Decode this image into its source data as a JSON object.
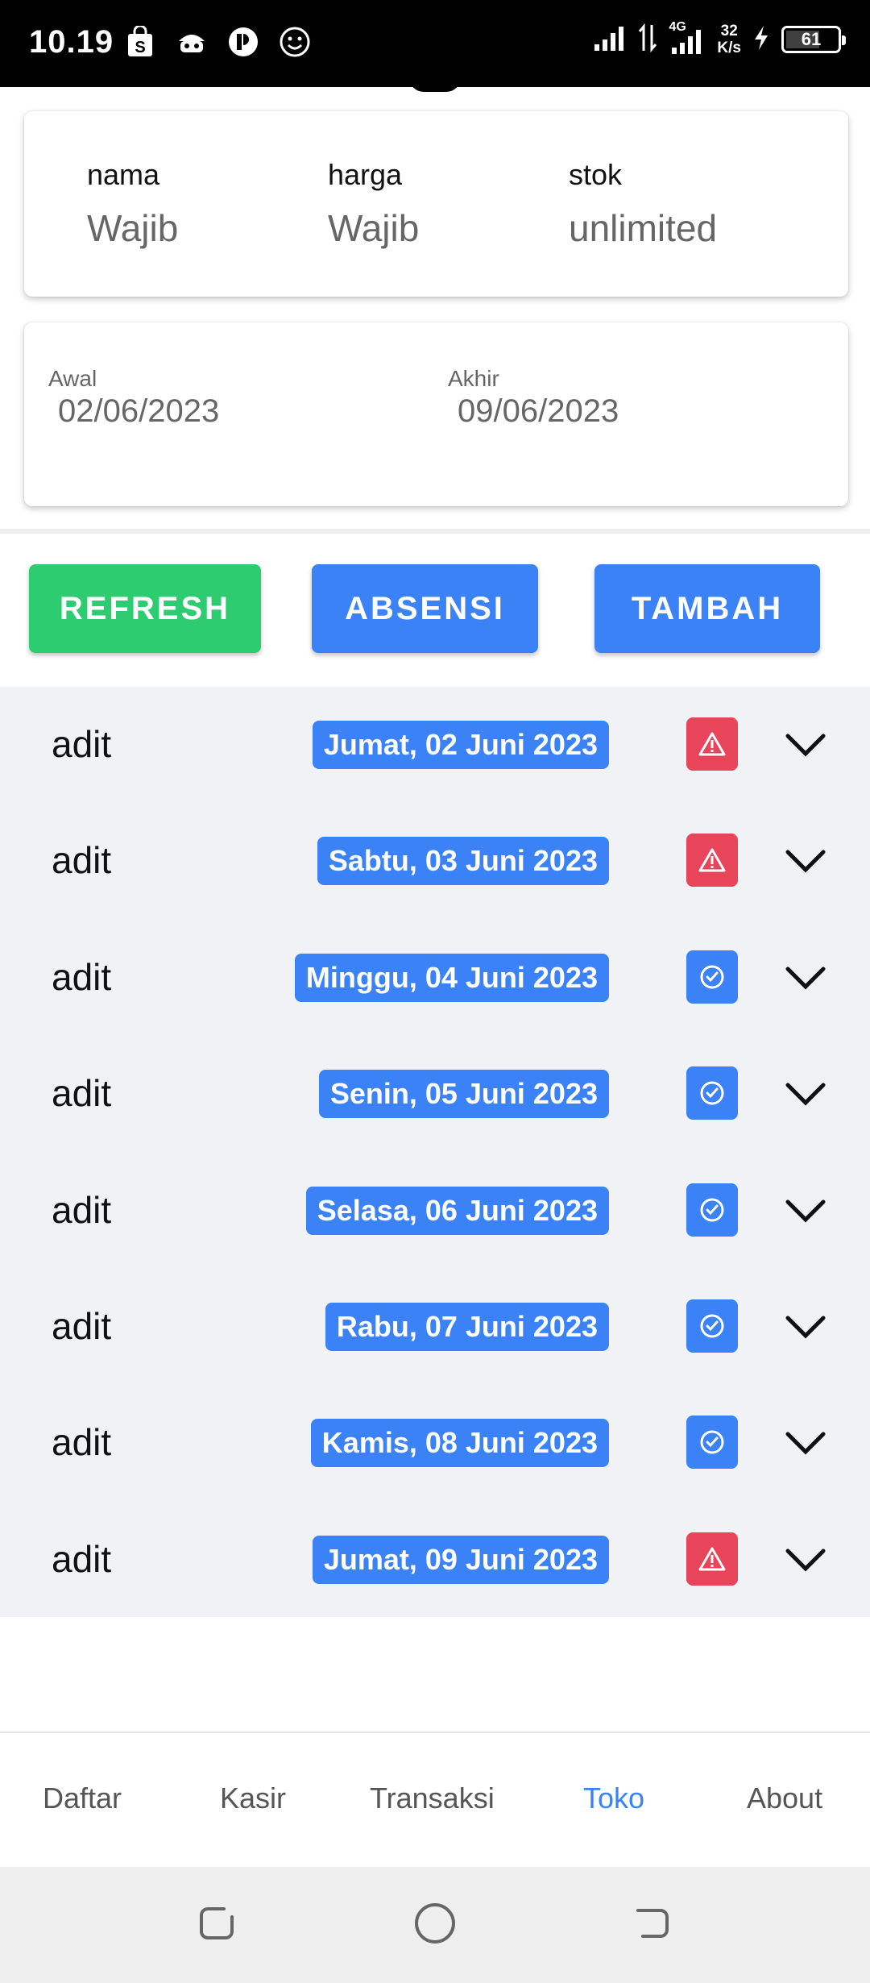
{
  "status_bar": {
    "time": "10.19",
    "network_type": "4G",
    "speed_value": "32",
    "speed_unit": "K/s",
    "battery": "61"
  },
  "product_card": {
    "fields": [
      {
        "label": "nama",
        "value": "Wajib"
      },
      {
        "label": "harga",
        "value": "Wajib"
      },
      {
        "label": "stok",
        "value": "unlimited"
      }
    ]
  },
  "date_card": {
    "start": {
      "label": "Awal",
      "value": "02/06/2023"
    },
    "end": {
      "label": "Akhir",
      "value": "09/06/2023"
    }
  },
  "actions": {
    "refresh_label": "REFRESH",
    "absensi_label": "ABSENSI",
    "tambah_label": "TAMBAH"
  },
  "attendance": [
    {
      "name": "adit",
      "date": "Jumat, 02 Juni 2023",
      "status": "warning"
    },
    {
      "name": "adit",
      "date": "Sabtu, 03 Juni 2023",
      "status": "warning"
    },
    {
      "name": "adit",
      "date": "Minggu, 04 Juni 2023",
      "status": "checked"
    },
    {
      "name": "adit",
      "date": "Senin, 05 Juni 2023",
      "status": "checked"
    },
    {
      "name": "adit",
      "date": "Selasa, 06 Juni 2023",
      "status": "checked"
    },
    {
      "name": "adit",
      "date": "Rabu, 07 Juni 2023",
      "status": "checked"
    },
    {
      "name": "adit",
      "date": "Kamis, 08 Juni 2023",
      "status": "checked"
    },
    {
      "name": "adit",
      "date": "Jumat, 09 Juni 2023",
      "status": "warning"
    }
  ],
  "bottom_nav": {
    "items": [
      "Daftar",
      "Kasir",
      "Transaksi",
      "Toko",
      "About"
    ],
    "active": "Toko"
  },
  "colors": {
    "accent": "#3b82f6",
    "success": "#2ecc71",
    "danger": "#e8445a"
  }
}
